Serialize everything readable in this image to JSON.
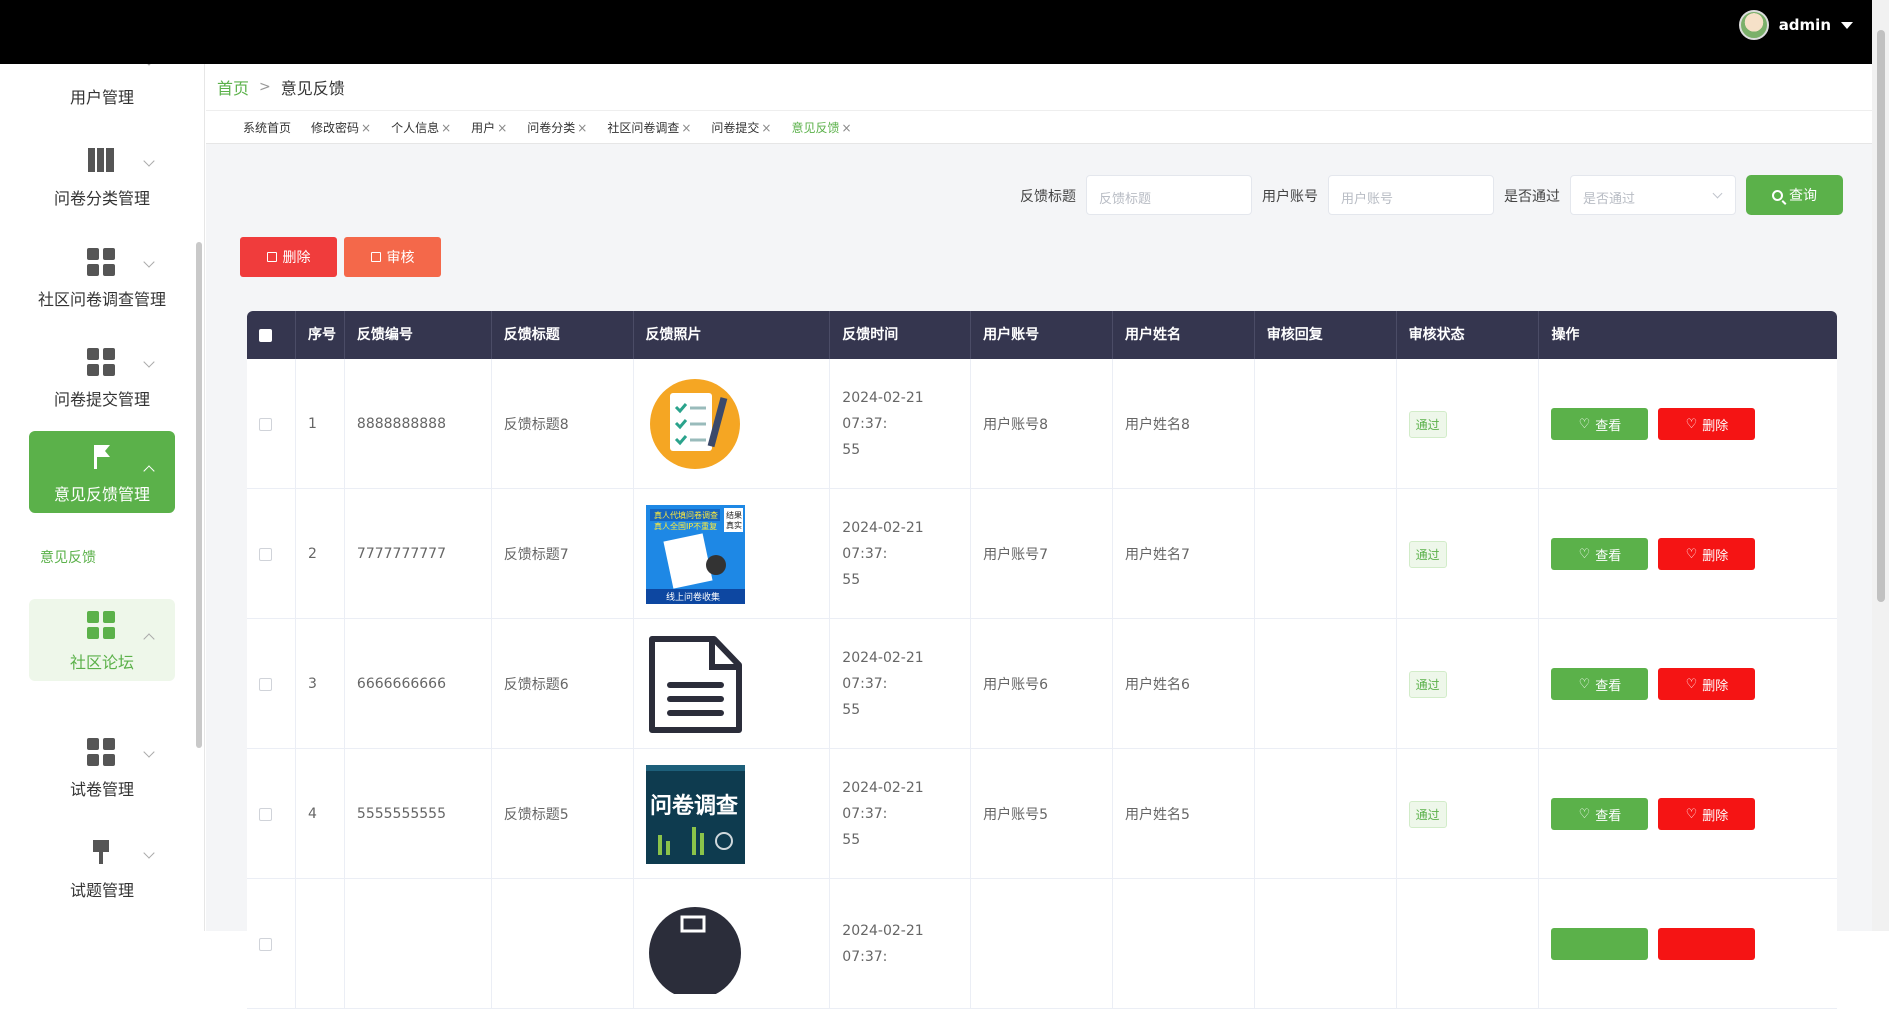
{
  "header": {
    "username": "admin"
  },
  "sidebar": {
    "items": [
      {
        "label": "用户管理",
        "icon": "user-icon"
      },
      {
        "label": "问卷分类管理",
        "icon": "book-icon"
      },
      {
        "label": "社区问卷调查管理",
        "icon": "grid-icon"
      },
      {
        "label": "问卷提交管理",
        "icon": "grid-icon"
      },
      {
        "label": "意见反馈管理",
        "icon": "flag-icon"
      },
      {
        "label": "社区论坛",
        "icon": "grid-icon"
      },
      {
        "label": "试卷管理",
        "icon": "grid-icon"
      },
      {
        "label": "试题管理",
        "icon": "brush-icon"
      }
    ],
    "sub_item": "意见反馈"
  },
  "breadcrumb": {
    "home": "首页",
    "sep": ">",
    "current": "意见反馈"
  },
  "tabs": [
    {
      "label": "系统首页",
      "closable": false
    },
    {
      "label": "修改密码",
      "closable": true
    },
    {
      "label": "个人信息",
      "closable": true
    },
    {
      "label": "用户",
      "closable": true
    },
    {
      "label": "问卷分类",
      "closable": true
    },
    {
      "label": "社区问卷调查",
      "closable": true
    },
    {
      "label": "问卷提交",
      "closable": true
    },
    {
      "label": "意见反馈",
      "closable": true,
      "active": true
    }
  ],
  "search": {
    "title_label": "反馈标题",
    "title_placeholder": "反馈标题",
    "account_label": "用户账号",
    "account_placeholder": "用户账号",
    "pass_label": "是否通过",
    "pass_placeholder": "是否通过",
    "query_button": "查询"
  },
  "actions": {
    "delete": "删除",
    "audit": "审核"
  },
  "table": {
    "headers": [
      "序号",
      "反馈编号",
      "反馈标题",
      "反馈照片",
      "反馈时间",
      "用户账号",
      "用户姓名",
      "审核回复",
      "审核状态",
      "操作"
    ],
    "rows": [
      {
        "index": "1",
        "code": "8888888888",
        "title": "反馈标题8",
        "time1": "2024-02-21 07:37:",
        "time2": "55",
        "account": "用户账号8",
        "name": "用户姓名8",
        "reply": "",
        "status": "通过",
        "view": "查看",
        "del": "删除"
      },
      {
        "index": "2",
        "code": "7777777777",
        "title": "反馈标题7",
        "time1": "2024-02-21 07:37:",
        "time2": "55",
        "account": "用户账号7",
        "name": "用户姓名7",
        "reply": "",
        "status": "通过",
        "view": "查看",
        "del": "删除"
      },
      {
        "index": "3",
        "code": "6666666666",
        "title": "反馈标题6",
        "time1": "2024-02-21 07:37:",
        "time2": "55",
        "account": "用户账号6",
        "name": "用户姓名6",
        "reply": "",
        "status": "通过",
        "view": "查看",
        "del": "删除"
      },
      {
        "index": "4",
        "code": "5555555555",
        "title": "反馈标题5",
        "time1": "2024-02-21 07:37:",
        "time2": "55",
        "account": "用户账号5",
        "name": "用户姓名5",
        "reply": "",
        "status": "通过",
        "view": "查看",
        "del": "删除"
      },
      {
        "index": "",
        "code": "",
        "title": "",
        "time1": "2024-02-21 07:37:",
        "time2": "",
        "account": "",
        "name": "",
        "reply": "",
        "status": "",
        "view": "",
        "del": ""
      }
    ],
    "thumb_texts": {
      "t2_a": "真人代填问卷调查",
      "t2_b": "真人全国IP不重复",
      "t2_c": "结果",
      "t2_d": "真实",
      "t2_e": "线上问卷收集",
      "t4": "问卷调查"
    }
  },
  "colors": {
    "primary": "#5bb14a",
    "danger": "#f51414",
    "header_bg": "#35364f"
  }
}
